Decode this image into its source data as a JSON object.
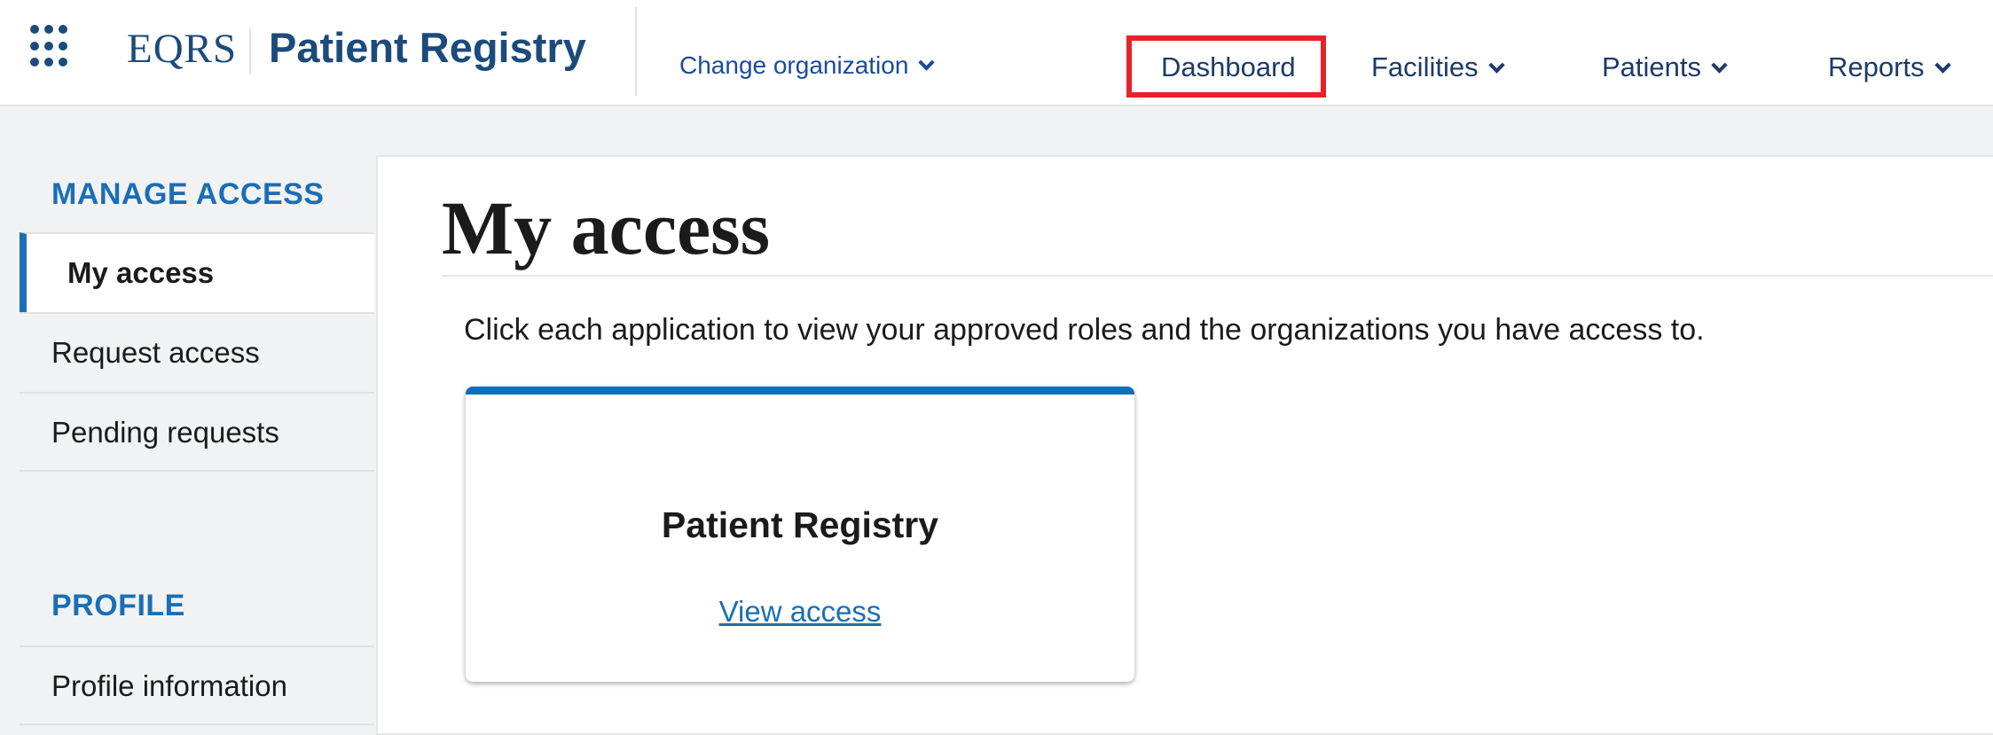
{
  "header": {
    "brand": "EQRS",
    "product": "Patient Registry",
    "change_org_label": "Change organization",
    "nav": {
      "dashboard": "Dashboard",
      "facilities": "Facilities",
      "patients": "Patients",
      "reports": "Reports"
    },
    "icons": {
      "apps": "grid-apps-icon",
      "dropdown": "chevron-down-icon"
    },
    "colors": {
      "brand": "#1b4b7a",
      "highlight": "#e5222b"
    }
  },
  "sidebar": {
    "manage_heading": "MANAGE ACCESS",
    "items": [
      {
        "label": "My access",
        "active": true
      },
      {
        "label": "Request access",
        "active": false
      },
      {
        "label": "Pending requests",
        "active": false
      }
    ],
    "profile_heading": "PROFILE",
    "profile_items": [
      {
        "label": "Profile information",
        "active": false
      }
    ],
    "accent_color": "#1a6eb5"
  },
  "main": {
    "title": "My access",
    "intro": "Click each application to view your approved roles and the organizations you have access to.",
    "cards": [
      {
        "title": "Patient Registry",
        "link": "View access"
      }
    ],
    "card_accent": "#0b6fbf"
  }
}
